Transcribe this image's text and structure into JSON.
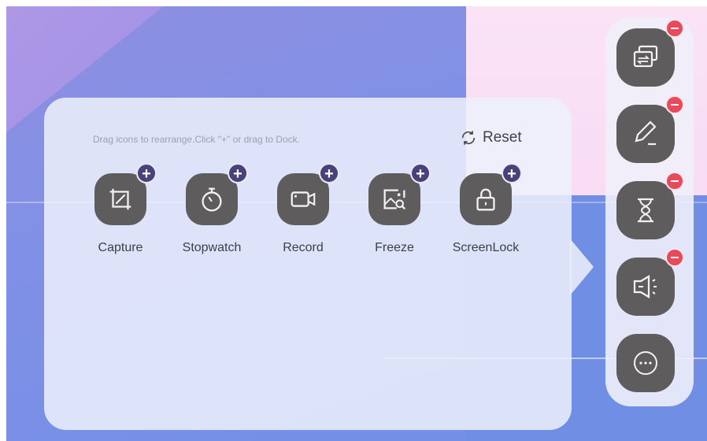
{
  "panel": {
    "hint": "Drag icons to rearrange.Click \"+\" or drag to Dock.",
    "reset_label": "Reset",
    "tools": [
      {
        "label": "Capture",
        "icon": "crop-icon",
        "add": "+"
      },
      {
        "label": "Stopwatch",
        "icon": "stopwatch-icon",
        "add": "+"
      },
      {
        "label": "Record",
        "icon": "video-camera-icon",
        "add": "+"
      },
      {
        "label": "Freeze",
        "icon": "image-search-icon",
        "add": "+"
      },
      {
        "label": "ScreenLock",
        "icon": "lock-icon",
        "add": "+"
      }
    ]
  },
  "dock": {
    "items": [
      {
        "icon": "screen-switch-icon",
        "removable": true
      },
      {
        "icon": "pen-icon",
        "removable": true
      },
      {
        "icon": "hourglass-icon",
        "removable": true
      },
      {
        "icon": "speaker-icon",
        "removable": true
      },
      {
        "icon": "more-icon",
        "removable": false
      }
    ]
  },
  "colors": {
    "tile": "#5e5c5d",
    "add_badge": "#49427a",
    "remove_badge": "#e84a5b",
    "panel": "#eef1fc"
  }
}
